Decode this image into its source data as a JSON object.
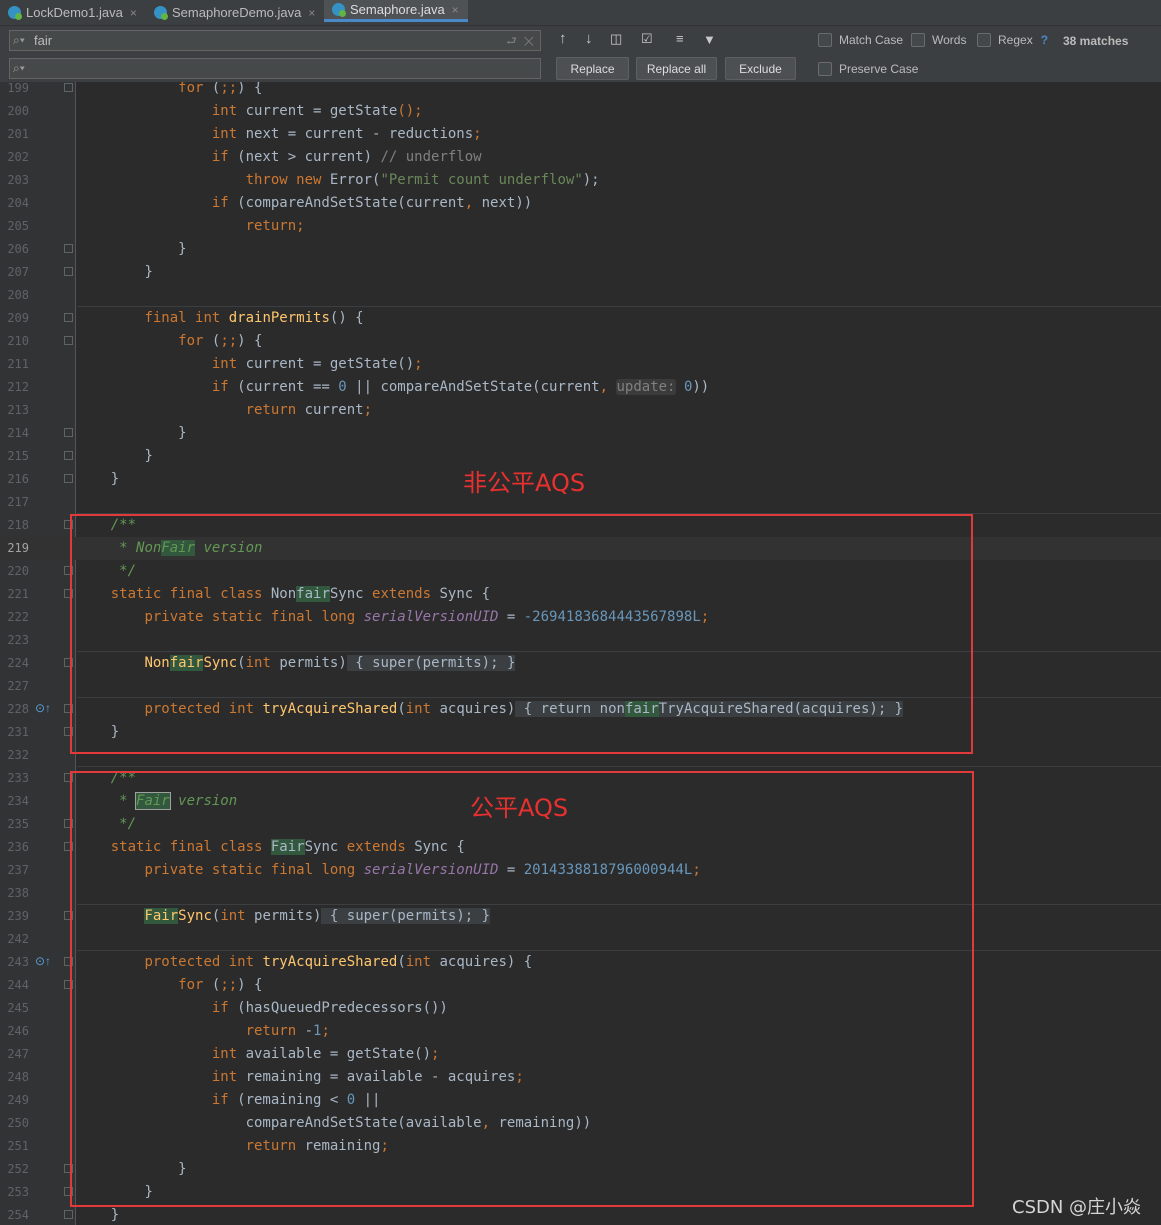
{
  "tabs": [
    {
      "label": "LockDemo1.java",
      "close": "×"
    },
    {
      "label": "SemaphoreDemo.java",
      "close": "×"
    },
    {
      "label": "Semaphore.java",
      "close": "×"
    }
  ],
  "search": {
    "value": "fair",
    "history_icon": "⮐",
    "clear_icon": "✕",
    "replace_value": ""
  },
  "find_toolbar": {
    "prev_icon": "↑",
    "next_icon": "↓",
    "select_all_icon": "◫",
    "filter_icon": "▼",
    "match_case": "Match Case",
    "words": "Words",
    "regex": "Regex",
    "regex_help": "?",
    "matches": "38 matches",
    "replace": "Replace",
    "replace_all": "Replace all",
    "exclude": "Exclude",
    "preserve_case": "Preserve Case"
  },
  "line_numbers": [
    "199",
    "200",
    "201",
    "202",
    "203",
    "204",
    "205",
    "206",
    "207",
    "208",
    "209",
    "210",
    "211",
    "212",
    "213",
    "214",
    "215",
    "216",
    "217",
    "218",
    "219",
    "220",
    "221",
    "222",
    "223",
    "224",
    "227",
    "228",
    "231",
    "232",
    "233",
    "234",
    "235",
    "236",
    "237",
    "238",
    "239",
    "242",
    "243",
    "244",
    "245",
    "246",
    "247",
    "248",
    "249",
    "250",
    "251",
    "252",
    "253",
    "254"
  ],
  "code": {
    "l199": [
      "for",
      " (",
      ";;",
      ") {"
    ],
    "l200": [
      "int",
      " current = ",
      "getState",
      "();"
    ],
    "l201": [
      "int",
      " next = current - reductions",
      ";"
    ],
    "l202": [
      "if",
      " (next > current) ",
      "// underflow"
    ],
    "l203": [
      "throw new",
      " Error(",
      "\"Permit count underflow\"",
      ");"
    ],
    "l204": [
      "if",
      " (compareAndSetState(current",
      ",",
      " next))"
    ],
    "l205": [
      "return;"
    ],
    "l206": [
      "}"
    ],
    "l207": [
      "}"
    ],
    "l209": [
      "final int",
      " ",
      "drainPermits",
      "() {"
    ],
    "l210": [
      "for",
      " (",
      ";;",
      ") {"
    ],
    "l211": [
      "int",
      " current = getState()",
      ";"
    ],
    "l212": [
      "if",
      " (current == ",
      "0",
      " || compareAndSetState(current",
      ",",
      " ",
      "update:",
      " ",
      "0",
      "))"
    ],
    "l213": [
      "return",
      " current",
      ";"
    ],
    "l214": [
      "}"
    ],
    "l215": [
      "}"
    ],
    "l216": [
      "}"
    ],
    "l218": [
      "/**"
    ],
    "l219": [
      " * ",
      "Non",
      "Fair",
      " version"
    ],
    "l220": [
      " */"
    ],
    "l221": [
      "static final class",
      " Non",
      "fair",
      "Sync ",
      "extends",
      " Sync {"
    ],
    "l222": [
      "private static final long",
      " ",
      "serialVersionUID",
      " = ",
      "-2694183684443567898L",
      ";"
    ],
    "l224": [
      "Non",
      "fair",
      "Sync",
      "(",
      "int",
      " permits)",
      " { ",
      "super",
      "(permits)",
      ";",
      " }"
    ],
    "l228": [
      "protected int",
      " ",
      "tryAcquireShared",
      "(",
      "int",
      " acquires)",
      " { ",
      "return",
      " non",
      "fair",
      "TryAcquireShared(acquires)",
      ";",
      " }"
    ],
    "l231": [
      "}"
    ],
    "l233": [
      "/**"
    ],
    "l234": [
      " * ",
      "Fair",
      " version"
    ],
    "l235": [
      " */"
    ],
    "l236": [
      "static final class",
      " ",
      "Fair",
      "Sync ",
      "extends",
      " Sync {"
    ],
    "l237": [
      "private static final long",
      " ",
      "serialVersionUID",
      " = ",
      "2014338818796000944L",
      ";"
    ],
    "l239": [
      "Fair",
      "Sync",
      "(",
      "int",
      " permits)",
      " { ",
      "super",
      "(permits)",
      ";",
      " }"
    ],
    "l243": [
      "protected int",
      " ",
      "tryAcquireShared",
      "(",
      "int",
      " acquires) {"
    ],
    "l244": [
      "for",
      " (",
      ";;",
      ") {"
    ],
    "l245": [
      "if",
      " (hasQueuedPredecessors())"
    ],
    "l246": [
      "return",
      " -",
      "1",
      ";"
    ],
    "l247": [
      "int",
      " available = getState()",
      ";"
    ],
    "l248": [
      "int",
      " remaining = available - acquires",
      ";"
    ],
    "l249": [
      "if",
      " (remaining < ",
      "0",
      " ||"
    ],
    "l250": [
      "compareAndSetState(available",
      ",",
      " remaining))"
    ],
    "l251": [
      "return",
      " remaining",
      ";"
    ],
    "l252": [
      "}"
    ],
    "l253": [
      "}"
    ],
    "l254": [
      "}"
    ]
  },
  "annotations": {
    "nonfair": "非公平AQS",
    "fair": "公平AQS"
  },
  "watermark": "CSDN @庄小焱"
}
